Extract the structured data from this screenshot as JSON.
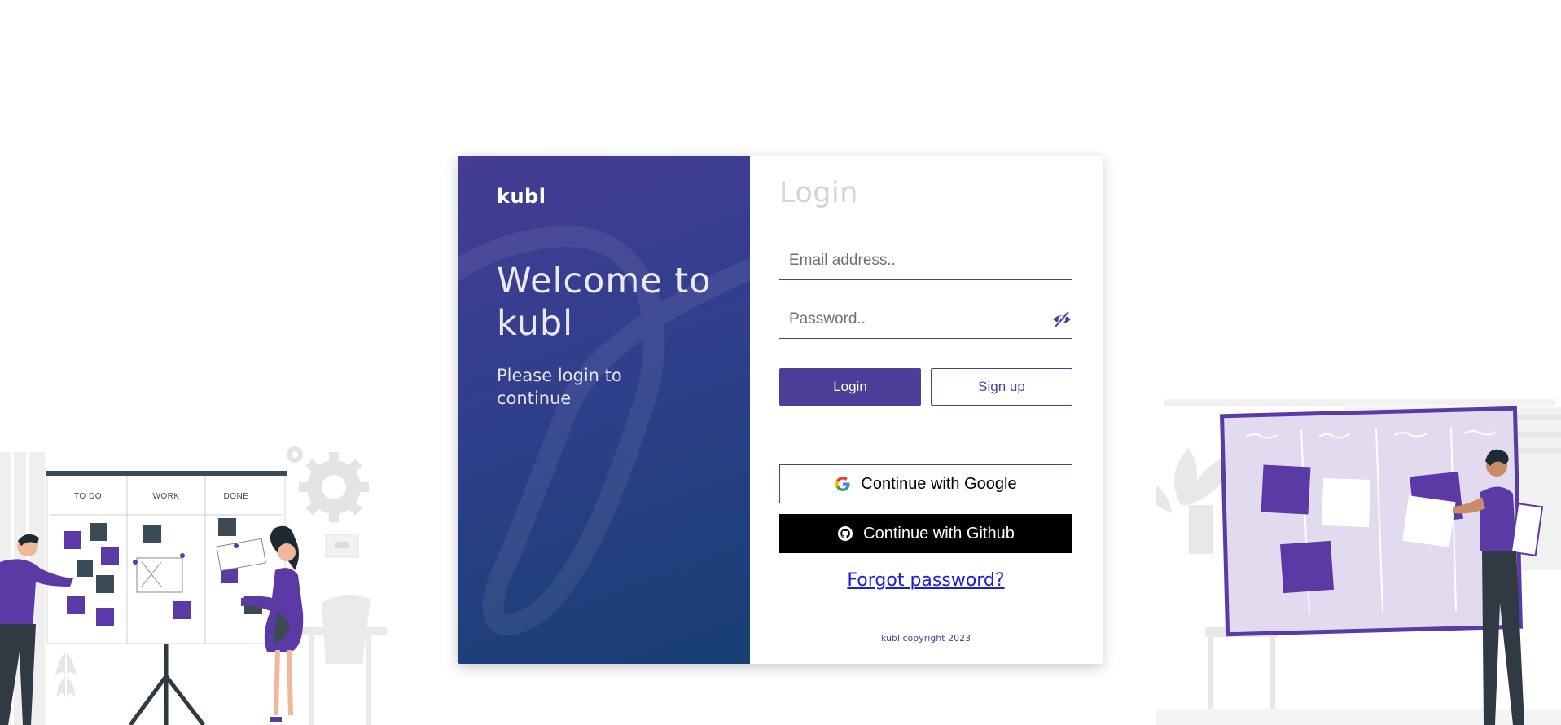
{
  "colors": {
    "brand_purple": "#4b3f99",
    "panel_gradient_start": "#463c94",
    "panel_gradient_end": "#173f72",
    "link_blue": "#1a1ae0",
    "github_black": "#000000"
  },
  "welcome_panel": {
    "brand": "kubl",
    "heading": "Welcome to kubl",
    "subtitle": "Please login to continue"
  },
  "login_form": {
    "title": "Login",
    "email": {
      "value": "",
      "placeholder": "Email address.."
    },
    "password": {
      "value": "",
      "placeholder": "Password..",
      "toggle_icon": "eye-slash-icon"
    },
    "login_label": "Login",
    "signup_label": "Sign up",
    "google_label": "Continue with Google",
    "google_icon": "google-icon",
    "github_label": "Continue with Github",
    "github_icon": "github-icon",
    "forgot_label": "Forgot password?",
    "copyright": "kubl copyright 2023"
  },
  "left_board": {
    "columns": [
      "TO DO",
      "WORK",
      "DONE"
    ]
  }
}
